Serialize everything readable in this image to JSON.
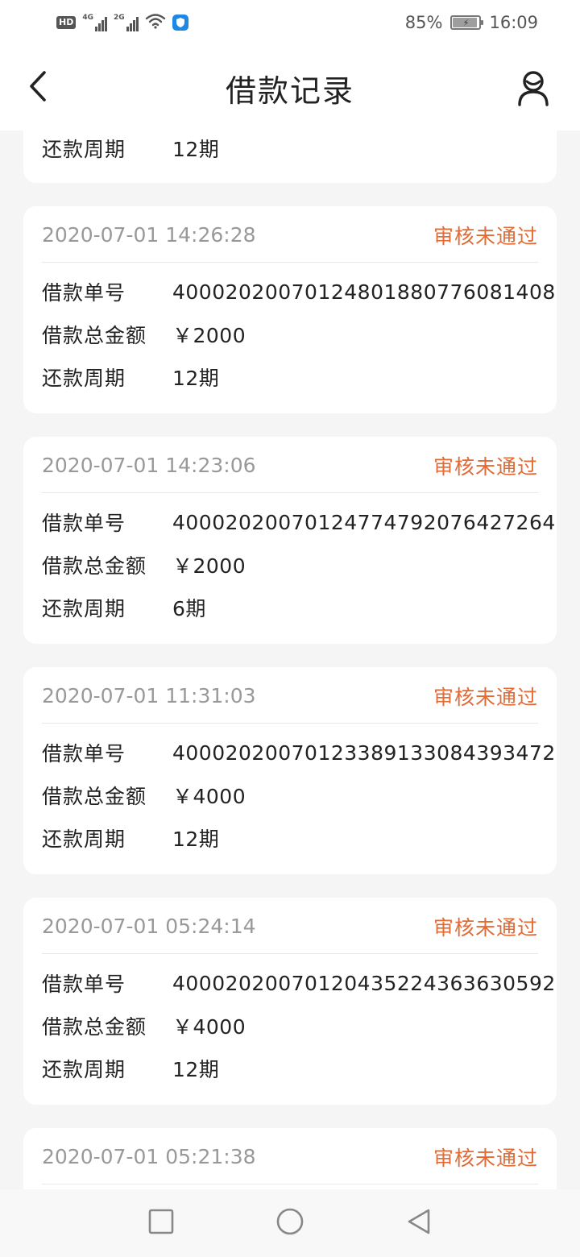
{
  "status_bar": {
    "hd": "HD",
    "network1": "4G",
    "network2": "2G",
    "battery": "85%",
    "time": "16:09",
    "icons": [
      "hd-icon",
      "signal-4g-icon",
      "signal-2g-icon",
      "wifi-icon",
      "shield-icon",
      "battery-icon"
    ]
  },
  "header": {
    "title": "借款记录",
    "back_icon": "chevron-left-icon",
    "profile_icon": "user-icon"
  },
  "labels": {
    "loan_no": "借款单号",
    "total": "借款总金额",
    "period": "还款周期"
  },
  "partial_card": {
    "period_label": "还款周期",
    "period_value": "12期"
  },
  "records": [
    {
      "time": "2020-07-01 14:26:28",
      "status": "审核未通过",
      "loan_no": "40002020070124801880776081408",
      "amount": "￥2000",
      "period": "12期"
    },
    {
      "time": "2020-07-01 14:23:06",
      "status": "审核未通过",
      "loan_no": "40002020070124774792076427264",
      "amount": "￥2000",
      "period": "6期"
    },
    {
      "time": "2020-07-01 11:31:03",
      "status": "审核未通过",
      "loan_no": "40002020070123389133084393472",
      "amount": "￥4000",
      "period": "12期"
    },
    {
      "time": "2020-07-01 05:24:14",
      "status": "审核未通过",
      "loan_no": "40002020070120435224363630592",
      "amount": "￥4000",
      "period": "12期"
    }
  ],
  "partial_bottom_card": {
    "time": "2020-07-01 05:21:38",
    "status": "审核未通过"
  },
  "colors": {
    "status_rejected": "#e36a33",
    "time_gray": "#999999",
    "background": "#f5f5f5"
  },
  "nav_bar": {
    "icons": [
      "square-icon",
      "circle-icon",
      "triangle-back-icon"
    ]
  }
}
